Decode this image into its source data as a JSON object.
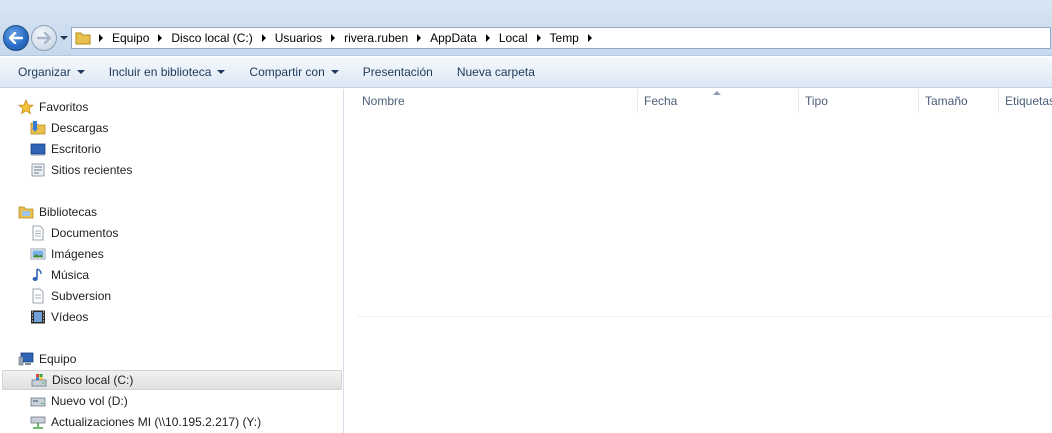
{
  "address": {
    "crumbs": [
      "Equipo",
      "Disco local (C:)",
      "Usuarios",
      "rivera.ruben",
      "AppData",
      "Local",
      "Temp"
    ]
  },
  "toolbar": {
    "organize": "Organizar",
    "include_library": "Incluir en biblioteca",
    "share": "Compartir con",
    "slideshow": "Presentación",
    "new_folder": "Nueva carpeta"
  },
  "nav": {
    "favorites": {
      "label": "Favoritos",
      "items": [
        "Descargas",
        "Escritorio",
        "Sitios recientes"
      ]
    },
    "libraries": {
      "label": "Bibliotecas",
      "items": [
        "Documentos",
        "Imágenes",
        "Música",
        "Subversion",
        "Vídeos"
      ]
    },
    "computer": {
      "label": "Equipo",
      "items": [
        "Disco local (C:)",
        "Nuevo vol (D:)",
        "Actualizaciones MI (\\\\10.195.2.217) (Y:)"
      ]
    }
  },
  "columns": [
    "Nombre",
    "Fecha",
    "Tipo",
    "Tamaño",
    "Etiquetas"
  ],
  "colors": {
    "back_button": "#2a6fc8",
    "command_text": "#1e395b",
    "header_text": "#4c607a",
    "selection": "#e1e1e1"
  }
}
